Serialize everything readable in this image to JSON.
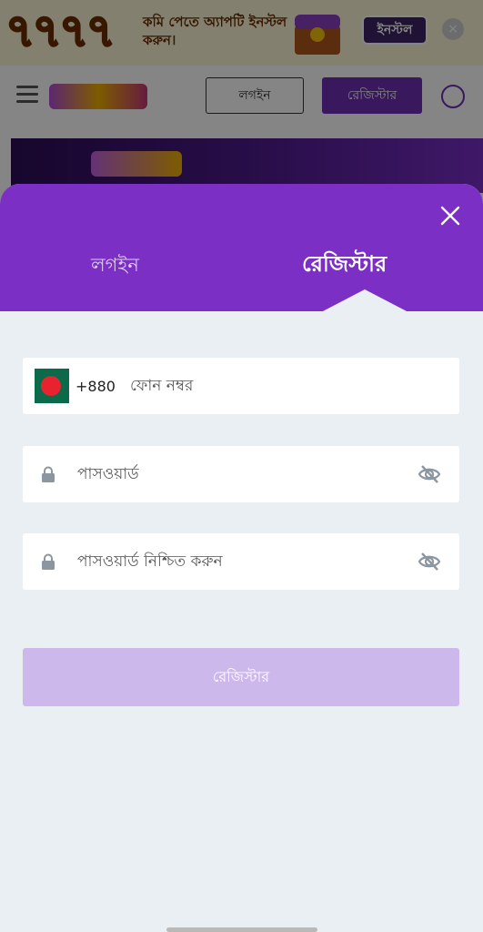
{
  "install_bar": {
    "brand_digits": "৭৭৭৭",
    "promo_text": "কমি পেতে অ্যাপটি ইনস্টল করুন।",
    "install_label": "ইনস্টল",
    "close_glyph": "×"
  },
  "nav": {
    "login_label": "লগইন",
    "register_label": "রেজিস্টার"
  },
  "modal": {
    "close_glyph": "×",
    "tabs": [
      {
        "label": "লগইন",
        "active": false
      },
      {
        "label": "রেজিস্টার",
        "active": true
      }
    ],
    "phone": {
      "country_code": "+880",
      "placeholder": "ফোন নম্বর",
      "flag_icon": "bangladesh-flag-icon"
    },
    "password": {
      "placeholder": "পাসওয়ার্ড",
      "icons": [
        "lock-icon",
        "eye-off-icon"
      ]
    },
    "confirm_password": {
      "placeholder": "পাসওয়ার্ড নিশ্চিত করুন",
      "icons": [
        "lock-icon",
        "eye-off-icon"
      ]
    },
    "submit_label": "রেজিস্টার"
  },
  "colors": {
    "brand_purple": "#7b2fc4",
    "button_disabled": "#cdb8ec",
    "panel_bg": "#e9eff2"
  }
}
